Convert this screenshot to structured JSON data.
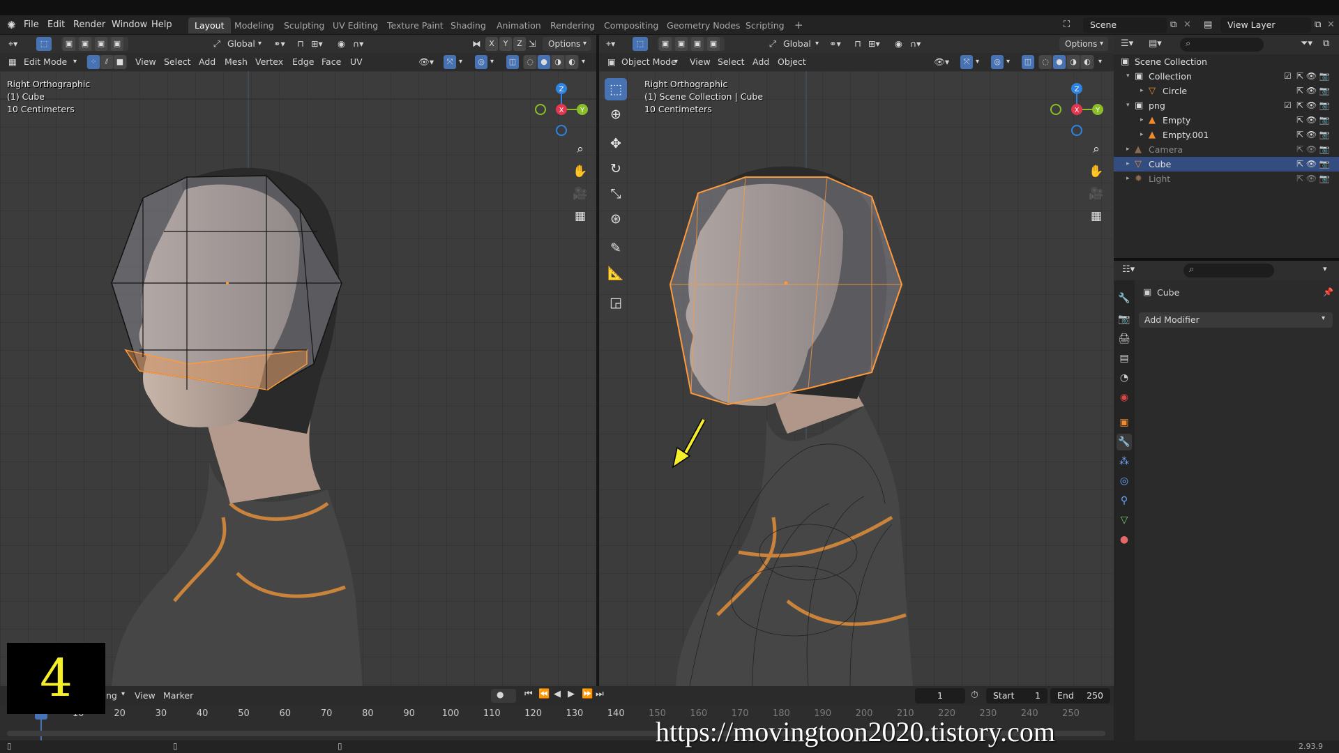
{
  "menubar": {
    "items": [
      "File",
      "Edit",
      "Render",
      "Window",
      "Help"
    ],
    "workspaces": [
      "Layout",
      "Modeling",
      "Sculpting",
      "UV Editing",
      "Texture Paint",
      "Shading",
      "Animation",
      "Rendering",
      "Compositing",
      "Geometry Nodes",
      "Scripting"
    ],
    "active_workspace": "Layout",
    "add_tab": "+",
    "scene": "Scene",
    "view_layer": "View Layer"
  },
  "left_viewport": {
    "transform_orientation": "Global",
    "axes": [
      "X",
      "Y",
      "Z"
    ],
    "options_label": "Options",
    "mode": "Edit Mode",
    "menus": [
      "View",
      "Select",
      "Add",
      "Mesh",
      "Vertex",
      "Edge",
      "Face",
      "UV"
    ],
    "info_lines": [
      "Right Orthographic",
      "(1) Cube",
      "10 Centimeters"
    ]
  },
  "right_viewport": {
    "transform_orientation": "Global",
    "options_label": "Options",
    "mode": "Object Mode",
    "menus": [
      "View",
      "Select",
      "Add",
      "Object"
    ],
    "info_lines": [
      "Right Orthographic",
      "(1) Scene Collection | Cube",
      "10 Centimeters"
    ]
  },
  "gizmo": {
    "x_label": "X",
    "y_label": "Y",
    "z_label": "Z",
    "x_color": "#e5364f",
    "y_color": "#8bbd2b",
    "z_color": "#2f84e3"
  },
  "outliner": {
    "rows": [
      {
        "label": "Scene Collection",
        "icon": "scene-collection-icon",
        "indent": 0,
        "selected": false,
        "dim": false
      },
      {
        "label": "Collection",
        "icon": "collection-icon",
        "indent": 1,
        "selected": false,
        "dim": false
      },
      {
        "label": "Circle",
        "icon": "mesh-object-icon",
        "indent": 2,
        "selected": false,
        "dim": false
      },
      {
        "label": "png",
        "icon": "collection-icon",
        "indent": 1,
        "selected": false,
        "dim": false
      },
      {
        "label": "Empty",
        "icon": "empty-image-icon",
        "indent": 2,
        "selected": false,
        "dim": false
      },
      {
        "label": "Empty.001",
        "icon": "empty-image-icon",
        "indent": 2,
        "selected": false,
        "dim": false
      },
      {
        "label": "Camera",
        "icon": "camera-icon",
        "indent": 1,
        "selected": false,
        "dim": true
      },
      {
        "label": "Cube",
        "icon": "mesh-object-icon",
        "indent": 1,
        "selected": true,
        "dim": false
      },
      {
        "label": "Light",
        "icon": "light-icon",
        "indent": 1,
        "selected": false,
        "dim": true
      }
    ]
  },
  "properties": {
    "object_name": "Cube",
    "add_modifier": "Add Modifier"
  },
  "timeline": {
    "menus": [
      "ng",
      "View",
      "Marker"
    ],
    "current_frame": "1",
    "start_label": "Start",
    "start_value": "1",
    "end_label": "End",
    "end_value": "250",
    "ticks": [
      "10",
      "20",
      "30",
      "40",
      "50",
      "60",
      "70",
      "80",
      "90",
      "100",
      "110",
      "120",
      "130",
      "140",
      "150",
      "160",
      "170",
      "180",
      "190",
      "200",
      "210",
      "220",
      "230",
      "240",
      "250"
    ],
    "playhead_frame": 1
  },
  "status": {
    "version": "2.93.9"
  },
  "overlay": {
    "step_number": "4",
    "watermark_url": "https://movingtoon2020.tistory.com",
    "step_color": "#f5ee2a"
  }
}
